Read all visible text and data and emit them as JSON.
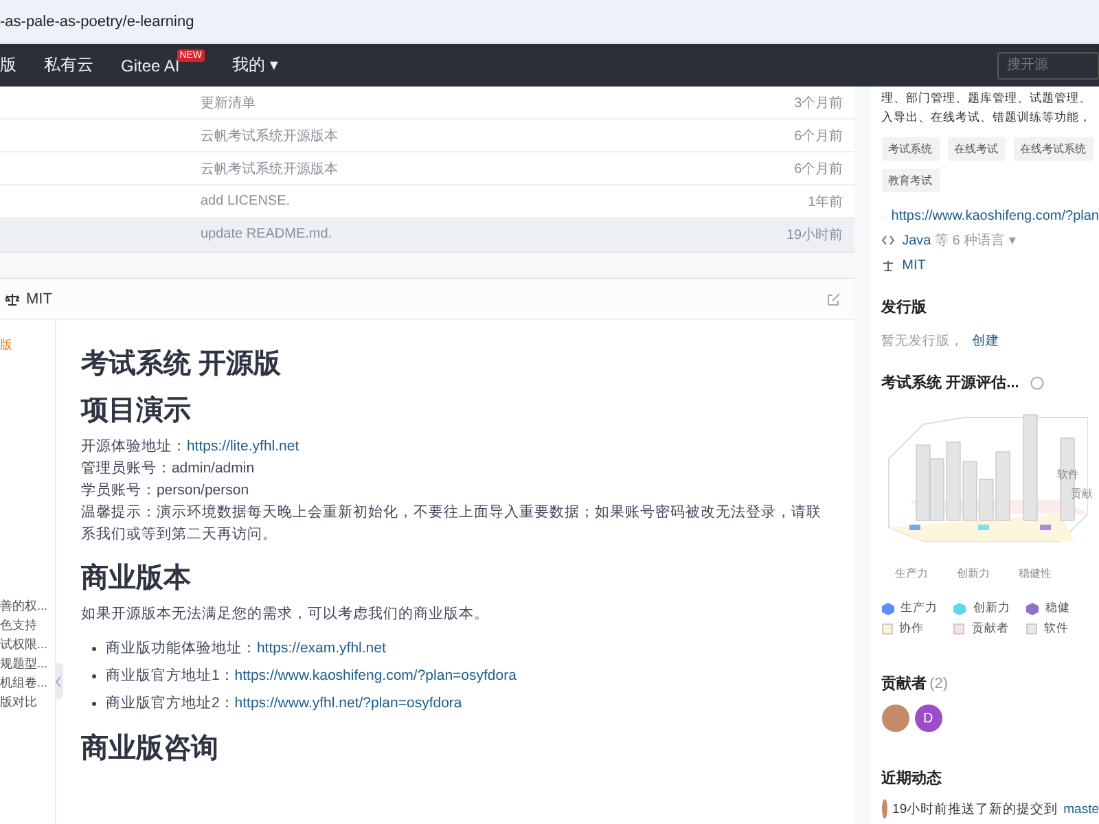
{
  "address_bar": {
    "url": "-as-pale-as-poetry/e-learning"
  },
  "nav": {
    "items": [
      {
        "label": "版"
      },
      {
        "label": "私有云"
      },
      {
        "label": "Gitee AI",
        "badge": "NEW"
      }
    ],
    "menu": {
      "label": "我的",
      "caret": "▾"
    },
    "search": {
      "placeholder": "搜开源"
    }
  },
  "commits": [
    {
      "message": "更新清单",
      "time": "3个月前",
      "hovered": false
    },
    {
      "message": "云帆考试系统开源版本",
      "time": "6个月前",
      "hovered": false
    },
    {
      "message": "云帆考试系统开源版本",
      "time": "6个月前",
      "hovered": false
    },
    {
      "message": "add LICENSE.",
      "time": "1年前",
      "hovered": false
    },
    {
      "message": "update README.md.",
      "time": "19小时前",
      "hovered": true
    }
  ],
  "readme": {
    "license": "MIT",
    "toc": [
      {
        "label": "版",
        "selected": true
      },
      {
        "label": "善的权...",
        "selected": false
      },
      {
        "label": "色支持",
        "selected": false
      },
      {
        "label": "试权限...",
        "selected": false
      },
      {
        "label": "规题型...",
        "selected": false
      },
      {
        "label": "机组卷...",
        "selected": false
      },
      {
        "label": "版对比",
        "selected": false
      }
    ],
    "blocks": [
      {
        "kind": "h1",
        "text": "考试系统 开源版"
      },
      {
        "kind": "h2",
        "text": "项目演示"
      },
      {
        "kind": "line",
        "text": "开源体验地址：",
        "link": "https://lite.yfhl.net"
      },
      {
        "kind": "line",
        "text": "管理员账号：admin/admin"
      },
      {
        "kind": "line",
        "text": "学员账号：person/person"
      },
      {
        "kind": "line",
        "text": "温馨提示：演示环境数据每天晚上会重新初始化，不要往上面导入重要数据；如果账号密码被改无法登录，请联系我们或等到第二天再访问。"
      },
      {
        "kind": "h2",
        "text": "商业版本"
      },
      {
        "kind": "para",
        "text": "如果开源版本无法满足您的需求，可以考虑我们的商业版本。"
      },
      {
        "kind": "bullet",
        "text": "商业版功能体验地址：",
        "link": "https://exam.yfhl.net"
      },
      {
        "kind": "bullet",
        "text": "商业版官方地址1：",
        "link": "https://www.kaoshifeng.com/?plan=osyfdora"
      },
      {
        "kind": "bullet",
        "text": "商业版官方地址2：",
        "link": "https://www.yfhl.net/?plan=osyfdora"
      },
      {
        "kind": "h2",
        "text": "商业版咨询"
      }
    ]
  },
  "sidebar": {
    "description": [
      "理、部门管理、题库管理、试题管理、",
      "入导出、在线考试、错题训练等功能，"
    ],
    "tags": [
      "考试系统",
      "在线考试",
      "在线考试系统",
      "教育考试"
    ],
    "website": "https://www.kaoshifeng.com/?plan",
    "language": {
      "name": "Java",
      "rest": "等 6 种语言",
      "caret": "▾"
    },
    "license": "MIT",
    "releases": {
      "title": "发行版",
      "empty": "暂无发行版，",
      "create": "创建"
    },
    "evaluation": {
      "title": "考试系统 开源评估...",
      "chart_labels": [
        "生产力",
        "创新力",
        "稳健性"
      ],
      "side_labels": [
        "软件",
        "贡献"
      ],
      "legend": [
        {
          "kind": "cube",
          "label": "生产力",
          "color": "#5b8ff9"
        },
        {
          "kind": "cube",
          "label": "创新力",
          "color": "#5ad8e6"
        },
        {
          "kind": "cube",
          "label": "稳健",
          "color": "#9270ca"
        },
        {
          "kind": "square",
          "label": "协作",
          "color": "#fdf3d0"
        },
        {
          "kind": "square",
          "label": "贡献者",
          "color": "#fbe4e0"
        },
        {
          "kind": "square",
          "label": "软件",
          "color": "#e8e8e8"
        }
      ]
    },
    "contributors": {
      "title": "贡献者",
      "count": "(2)",
      "avatars": [
        {
          "kind": "photo"
        },
        {
          "kind": "letter",
          "initial": "D"
        }
      ]
    },
    "activity": {
      "title": "近期动态",
      "text": "19小时前推送了新的提交到",
      "branch": "maste"
    }
  }
}
